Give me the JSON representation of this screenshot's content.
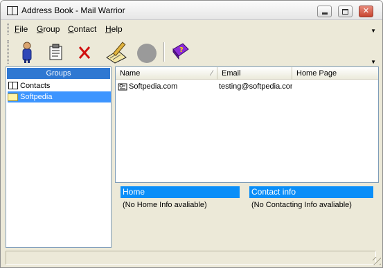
{
  "window": {
    "title": "Address Book - Mail Warrior",
    "icons": {
      "app": "address-book-icon",
      "minimize": "minimize-icon",
      "maximize": "maximize-icon",
      "close": "close-icon"
    }
  },
  "menu": [
    {
      "label": "File",
      "mnemonic": "F",
      "rest": "ile"
    },
    {
      "label": "Group",
      "mnemonic": "G",
      "rest": "roup"
    },
    {
      "label": "Contact",
      "mnemonic": "C",
      "rest": "ontact"
    },
    {
      "label": "Help",
      "mnemonic": "H",
      "rest": "elp"
    }
  ],
  "toolbar": {
    "buttons": [
      {
        "icon": "new-contact-icon"
      },
      {
        "icon": "properties-icon"
      },
      {
        "icon": "delete-icon"
      },
      {
        "icon": "edit-icon"
      },
      {
        "icon": "disabled-round-icon"
      },
      {
        "icon": "help-book-icon"
      }
    ]
  },
  "groups": {
    "header": "Groups",
    "items": [
      {
        "label": "Contacts",
        "icon": "address-book-icon",
        "selected": false
      },
      {
        "label": "Softpedia",
        "icon": "folder-icon",
        "selected": true
      }
    ]
  },
  "list": {
    "columns": [
      "Name",
      "Email",
      "Home Page"
    ],
    "sort_indicator": "∕",
    "rows": [
      {
        "name": "Softpedia.com",
        "email": "testing@softpedia.cor",
        "home_page": ""
      }
    ]
  },
  "info": {
    "home_title": "Home",
    "home_text": "(No Home Info avaliable)",
    "contact_title": "Contact info",
    "contact_text": "(No Contacting Info avaliable)"
  },
  "colors": {
    "header_blue": "#2f78d2",
    "selection_blue": "#3d95ff",
    "info_title_blue": "#0a8ef8",
    "window_bg": "#ece9d8"
  }
}
